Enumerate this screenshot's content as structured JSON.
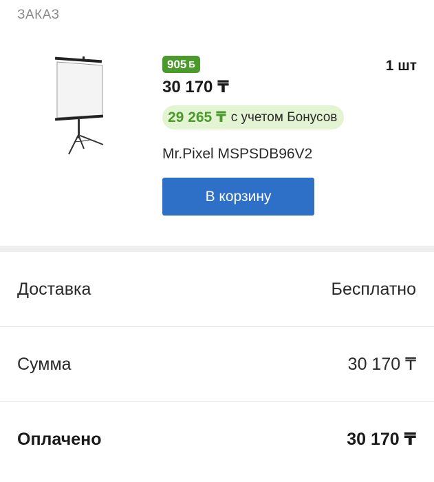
{
  "section": {
    "label": "ЗАКАЗ"
  },
  "product": {
    "image_icon": "projector-screen-icon",
    "bonus_points": "905",
    "bonus_coin_symbol": "Б",
    "price": "30 170 ₸",
    "quantity": "1 шт",
    "price_with_bonus": "29 265 ₸",
    "price_with_bonus_note": "с учетом Бонусов",
    "name": "Mr.Pixel MSPSDB96V2",
    "cart_button_label": "В корзину"
  },
  "summary": {
    "delivery": {
      "label": "Доставка",
      "value": "Бесплатно"
    },
    "total": {
      "label": "Сумма",
      "value": "30 170 ₸"
    },
    "paid": {
      "label": "Оплачено",
      "value": "30 170 ₸"
    }
  },
  "colors": {
    "accent_blue": "#2e70c8",
    "bonus_green": "#4a9a2c",
    "bonus_bg": "#e3f4d3"
  }
}
